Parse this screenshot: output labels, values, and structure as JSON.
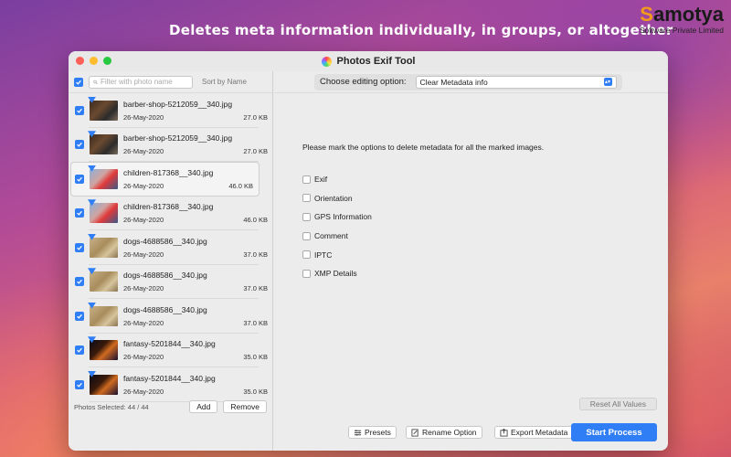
{
  "promo": {
    "headline": "Deletes meta information individually, in groups, or altogether",
    "brand_first": "S",
    "brand_rest": "amotya",
    "brand_sub": "Software Private Limited"
  },
  "window": {
    "title": "Photos Exif Tool"
  },
  "left": {
    "filter_placeholder": "Filter with photo name",
    "sort_label": "Sort by Name",
    "selected_count": "Photos Selected: 44 / 44",
    "add_label": "Add",
    "remove_label": "Remove",
    "photos": [
      {
        "name": "barber-shop-5212059__340.jpg",
        "date": "26-May-2020",
        "size": "27.0 KB",
        "checked": true,
        "thumb": "barber"
      },
      {
        "name": "barber-shop-5212059__340.jpg",
        "date": "26-May-2020",
        "size": "27.0 KB",
        "checked": true,
        "thumb": "barber"
      },
      {
        "name": "children-817368__340.jpg",
        "date": "26-May-2020",
        "size": "46.0 KB",
        "checked": true,
        "thumb": "child",
        "selected": true
      },
      {
        "name": "children-817368__340.jpg",
        "date": "26-May-2020",
        "size": "46.0 KB",
        "checked": true,
        "thumb": "child"
      },
      {
        "name": "dogs-4688586__340.jpg",
        "date": "26-May-2020",
        "size": "37.0 KB",
        "checked": true,
        "thumb": "dog"
      },
      {
        "name": "dogs-4688586__340.jpg",
        "date": "26-May-2020",
        "size": "37.0 KB",
        "checked": true,
        "thumb": "dog"
      },
      {
        "name": "dogs-4688586__340.jpg",
        "date": "26-May-2020",
        "size": "37.0 KB",
        "checked": true,
        "thumb": "dog"
      },
      {
        "name": "fantasy-5201844__340.jpg",
        "date": "26-May-2020",
        "size": "35.0 KB",
        "checked": true,
        "thumb": "fantasy"
      },
      {
        "name": "fantasy-5201844__340.jpg",
        "date": "26-May-2020",
        "size": "35.0 KB",
        "checked": true,
        "thumb": "fantasy"
      }
    ]
  },
  "right": {
    "option_label": "Choose editing option:",
    "option_value": "Clear Metadata info",
    "instruction": "Please mark the options to delete metadata for all the marked images.",
    "options": [
      "Exif",
      "Orientation",
      "GPS Information",
      "Comment",
      "IPTC",
      "XMP Details"
    ],
    "reset_label": "Reset All Values"
  },
  "bottom": {
    "presets_label": "Presets",
    "rename_label": "Rename Option",
    "export_label": "Export Metadata",
    "start_label": "Start Process"
  },
  "colors": {
    "accent": "#2f7ef5",
    "brand_orange": "#f39a1c"
  }
}
